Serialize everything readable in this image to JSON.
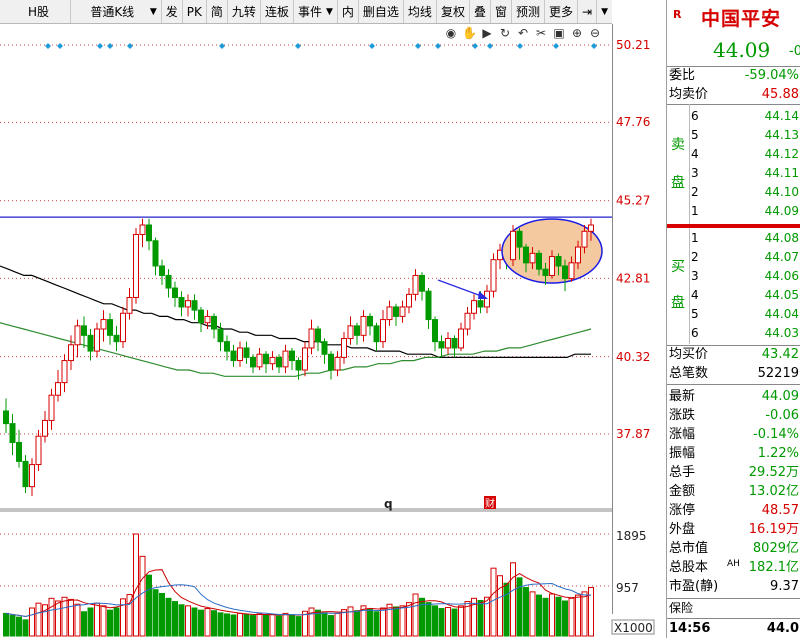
{
  "toolbar": {
    "items": [
      "H股",
      "普通K线",
      "发",
      "PK",
      "简",
      "九转",
      "连板",
      "事件",
      "内",
      "删自选",
      "均线",
      "复权",
      "叠",
      "窗",
      "预测",
      "更多"
    ]
  },
  "icons": [
    "eye-icon",
    "hand-icon",
    "play-icon",
    "redo-icon",
    "undo-icon",
    "scissors-icon",
    "lock-icon",
    "zoom-in-icon",
    "zoom-out-icon"
  ],
  "price_axis": [
    "50.21",
    "47.76",
    "45.27",
    "42.81",
    "40.32",
    "37.87"
  ],
  "volume_axis": [
    "1895",
    "957"
  ],
  "volume_unit": "X1000",
  "markers": {
    "q": "q",
    "cai": "财"
  },
  "colors": {
    "up": "#d60000",
    "down": "#009900",
    "accent": "#0000cc",
    "annotation_fill": "#f5c9a0"
  },
  "chart_data": {
    "type": "candlestick",
    "ylim": [
      37.0,
      51.0
    ],
    "levels": [
      50.21,
      47.76,
      45.27,
      42.81,
      40.32,
      37.87
    ],
    "resistance": 44.75,
    "candles": [
      [
        38.6,
        38.2,
        39.0,
        37.9
      ],
      [
        38.2,
        37.6,
        38.5,
        37.2
      ],
      [
        37.6,
        37.0,
        38.0,
        36.8
      ],
      [
        37.0,
        36.2,
        37.2,
        36.0
      ],
      [
        36.2,
        36.9,
        37.1,
        35.9
      ],
      [
        36.9,
        37.8,
        38.0,
        36.7
      ],
      [
        37.8,
        38.3,
        38.6,
        37.6
      ],
      [
        38.3,
        39.1,
        39.3,
        38.0
      ],
      [
        39.1,
        39.5,
        39.9,
        38.9
      ],
      [
        39.5,
        40.2,
        40.4,
        39.2
      ],
      [
        40.2,
        40.7,
        41.0,
        39.9
      ],
      [
        40.7,
        41.3,
        41.5,
        40.3
      ],
      [
        41.3,
        41.0,
        41.6,
        40.6
      ],
      [
        41.0,
        40.5,
        41.2,
        40.2
      ],
      [
        40.5,
        41.2,
        41.4,
        40.3
      ],
      [
        41.2,
        41.5,
        41.8,
        40.8
      ],
      [
        41.5,
        41.0,
        41.7,
        40.7
      ],
      [
        41.0,
        40.8,
        41.3,
        40.5
      ],
      [
        40.8,
        41.7,
        41.9,
        40.6
      ],
      [
        41.7,
        42.2,
        42.5,
        41.5
      ],
      [
        42.2,
        44.2,
        44.4,
        42.0
      ],
      [
        44.2,
        44.5,
        44.7,
        43.8
      ],
      [
        44.5,
        44.0,
        44.7,
        43.7
      ],
      [
        44.0,
        43.2,
        44.1,
        42.9
      ],
      [
        43.2,
        42.9,
        43.4,
        42.6
      ],
      [
        42.9,
        42.5,
        43.1,
        42.2
      ],
      [
        42.5,
        42.2,
        42.7,
        41.9
      ],
      [
        42.2,
        41.9,
        42.4,
        41.6
      ],
      [
        41.9,
        42.1,
        42.3,
        41.6
      ],
      [
        42.1,
        41.8,
        42.3,
        41.5
      ],
      [
        41.8,
        41.4,
        41.9,
        41.1
      ],
      [
        41.4,
        41.6,
        41.8,
        41.2
      ],
      [
        41.6,
        41.2,
        41.7,
        40.9
      ],
      [
        41.2,
        40.8,
        41.4,
        40.5
      ],
      [
        40.8,
        40.5,
        41.0,
        40.2
      ],
      [
        40.5,
        40.2,
        40.7,
        40.0
      ],
      [
        40.2,
        40.6,
        40.8,
        40.0
      ],
      [
        40.6,
        40.3,
        40.8,
        40.1
      ],
      [
        40.3,
        40.0,
        40.4,
        39.8
      ],
      [
        40.0,
        40.4,
        40.6,
        39.9
      ],
      [
        40.4,
        40.1,
        40.5,
        39.8
      ],
      [
        40.1,
        40.3,
        40.5,
        39.9
      ],
      [
        40.3,
        40.0,
        40.4,
        39.8
      ],
      [
        40.0,
        40.5,
        40.7,
        39.8
      ],
      [
        40.5,
        40.2,
        40.6,
        39.9
      ],
      [
        40.2,
        39.9,
        40.3,
        39.6
      ],
      [
        39.9,
        40.6,
        40.8,
        39.7
      ],
      [
        40.6,
        41.2,
        41.5,
        40.4
      ],
      [
        41.2,
        40.8,
        41.3,
        40.5
      ],
      [
        40.8,
        40.4,
        40.9,
        40.1
      ],
      [
        40.4,
        39.9,
        40.5,
        39.6
      ],
      [
        39.9,
        40.3,
        40.5,
        39.7
      ],
      [
        40.3,
        40.9,
        41.1,
        40.1
      ],
      [
        40.9,
        41.3,
        41.6,
        40.7
      ],
      [
        41.3,
        41.0,
        41.4,
        40.7
      ],
      [
        41.0,
        41.6,
        41.8,
        40.8
      ],
      [
        41.6,
        41.3,
        41.7,
        41.0
      ],
      [
        41.3,
        40.8,
        41.4,
        40.5
      ],
      [
        40.8,
        41.5,
        41.8,
        40.6
      ],
      [
        41.5,
        41.9,
        42.1,
        41.3
      ],
      [
        41.9,
        41.6,
        42.0,
        41.3
      ],
      [
        41.6,
        41.9,
        42.1,
        41.4
      ],
      [
        41.9,
        42.3,
        42.5,
        41.7
      ],
      [
        42.3,
        42.9,
        43.1,
        42.1
      ],
      [
        42.9,
        42.4,
        43.0,
        42.1
      ],
      [
        42.4,
        41.5,
        42.5,
        41.2
      ],
      [
        41.5,
        40.8,
        41.6,
        40.5
      ],
      [
        40.8,
        40.6,
        41.0,
        40.3
      ],
      [
        40.6,
        40.9,
        41.1,
        40.4
      ],
      [
        40.9,
        40.6,
        41.0,
        40.3
      ],
      [
        40.6,
        41.2,
        41.4,
        40.5
      ],
      [
        41.2,
        41.7,
        41.9,
        41.0
      ],
      [
        41.7,
        42.1,
        42.3,
        41.5
      ],
      [
        42.1,
        41.9,
        42.4,
        41.7
      ],
      [
        41.9,
        42.4,
        42.6,
        41.7
      ],
      [
        42.4,
        43.4,
        43.6,
        42.2
      ],
      [
        43.4,
        43.7,
        43.9,
        43.1
      ],
      [
        43.7,
        43.4,
        43.8,
        43.1
      ],
      [
        43.4,
        44.3,
        44.5,
        43.2
      ],
      [
        44.3,
        43.8,
        44.4,
        43.4
      ],
      [
        43.8,
        43.3,
        43.9,
        43.0
      ],
      [
        43.3,
        43.6,
        43.8,
        43.1
      ],
      [
        43.6,
        43.1,
        43.7,
        42.9
      ],
      [
        43.1,
        42.9,
        43.3,
        42.6
      ],
      [
        42.9,
        43.5,
        43.7,
        42.8
      ],
      [
        43.5,
        43.2,
        43.6,
        42.9
      ],
      [
        43.2,
        42.8,
        43.4,
        42.4
      ],
      [
        42.8,
        43.3,
        43.5,
        42.7
      ],
      [
        43.3,
        43.8,
        44.0,
        43.1
      ],
      [
        43.8,
        44.3,
        44.5,
        43.6
      ],
      [
        44.3,
        44.5,
        44.7,
        44.0
      ]
    ],
    "ma_series": [
      {
        "color": "#000000",
        "values": [
          43.2,
          43.1,
          43.0,
          42.9,
          42.9,
          42.8,
          42.7,
          42.6,
          42.5,
          42.4,
          42.3,
          42.2,
          42.1,
          42.0,
          42.0,
          41.9,
          41.8,
          41.8,
          41.7,
          41.7,
          41.6,
          41.6,
          41.5,
          41.5,
          41.4,
          41.4,
          41.3,
          41.3,
          41.2,
          41.2,
          41.1,
          41.1,
          41.0,
          41.0,
          41.0,
          40.9,
          40.9,
          40.9,
          40.8,
          40.8,
          40.8,
          40.7,
          40.7,
          40.7,
          40.6,
          40.6,
          40.6,
          40.5,
          40.5,
          40.5,
          40.5,
          40.4,
          40.4,
          40.4,
          40.4,
          40.3,
          40.3,
          40.3,
          40.3,
          40.3,
          40.3,
          40.3,
          40.3,
          40.3,
          40.3,
          40.3,
          40.3,
          40.3,
          40.3,
          40.3,
          40.3,
          40.3,
          40.4,
          40.4,
          40.4
        ]
      },
      {
        "color": "#2e8b2e",
        "values": [
          41.4,
          41.3,
          41.2,
          41.1,
          41.0,
          40.9,
          40.8,
          40.7,
          40.6,
          40.5,
          40.4,
          40.3,
          40.2,
          40.1,
          40.0,
          39.9,
          39.9,
          39.8,
          39.8,
          39.7,
          39.7,
          39.7,
          39.7,
          39.7,
          39.7,
          39.7,
          39.8,
          39.8,
          39.9,
          39.9,
          40.0,
          40.0,
          40.1,
          40.1,
          40.2,
          40.2,
          40.3,
          40.3,
          40.4,
          40.4,
          40.4,
          40.5,
          40.5,
          40.6,
          40.6,
          40.7,
          40.8,
          40.9,
          41.0,
          41.1,
          41.2
        ]
      }
    ],
    "volume": [
      420,
      380,
      350,
      300,
      520,
      610,
      580,
      700,
      650,
      720,
      680,
      590,
      450,
      520,
      610,
      560,
      480,
      520,
      690,
      770,
      1895,
      1480,
      1130,
      860,
      790,
      700,
      640,
      580,
      560,
      520,
      480,
      510,
      470,
      430,
      410,
      390,
      420,
      400,
      380,
      410,
      390,
      400,
      370,
      420,
      390,
      360,
      460,
      520,
      480,
      430,
      380,
      420,
      490,
      540,
      470,
      560,
      500,
      450,
      520,
      590,
      540,
      560,
      620,
      780,
      700,
      620,
      560,
      510,
      530,
      500,
      560,
      640,
      700,
      660,
      720,
      1260,
      1120,
      980,
      1360,
      1080,
      900,
      820,
      760,
      700,
      780,
      720,
      650,
      700,
      760,
      820,
      900
    ]
  },
  "quote": {
    "logo": "R",
    "name": "中国平安",
    "price": "44.09",
    "change_partial": "-0",
    "wei_bi_label": "委比",
    "wei_bi": "-59.04%",
    "avg_sell_label": "均卖价",
    "avg_sell": "45.88",
    "sell_label_1": "卖",
    "sell_label_2": "盘",
    "buy_label_1": "买",
    "buy_label_2": "盘",
    "asks": [
      [
        "6",
        "44.14"
      ],
      [
        "5",
        "44.13"
      ],
      [
        "4",
        "44.12"
      ],
      [
        "3",
        "44.11"
      ],
      [
        "2",
        "44.10"
      ],
      [
        "1",
        "44.09"
      ]
    ],
    "bids": [
      [
        "1",
        "44.08"
      ],
      [
        "2",
        "44.07"
      ],
      [
        "3",
        "44.06"
      ],
      [
        "4",
        "44.05"
      ],
      [
        "5",
        "44.04"
      ],
      [
        "6",
        "44.03"
      ]
    ],
    "avg_buy_label": "均买价",
    "avg_buy": "43.42",
    "total_count_label": "总笔数",
    "total_count": "52219",
    "stats": [
      {
        "label": "最新",
        "value": "44.09",
        "color": "#009900"
      },
      {
        "label": "涨跌",
        "value": "-0.06",
        "color": "#009900"
      },
      {
        "label": "涨幅",
        "value": "-0.14%",
        "color": "#009900"
      },
      {
        "label": "振幅",
        "value": "1.22%",
        "color": "#009900"
      },
      {
        "label": "总手",
        "value": "29.52万",
        "color": "#009900"
      },
      {
        "label": "金额",
        "value": "13.02亿",
        "color": "#009900"
      },
      {
        "label": "涨停",
        "value": "48.57",
        "color": "#d60000"
      },
      {
        "label": "外盘",
        "value": "16.19万",
        "color": "#d60000"
      },
      {
        "label": "总市值",
        "value": "8029亿",
        "color": "#009900"
      },
      {
        "label": "总股本",
        "value": "182.1亿",
        "color": "#009900"
      },
      {
        "label": "市盈(静)",
        "value": "9.37",
        "color": "#000000"
      }
    ],
    "ah_tag": "AH",
    "sector": "保险",
    "time": "14:56",
    "last": "44.0"
  }
}
